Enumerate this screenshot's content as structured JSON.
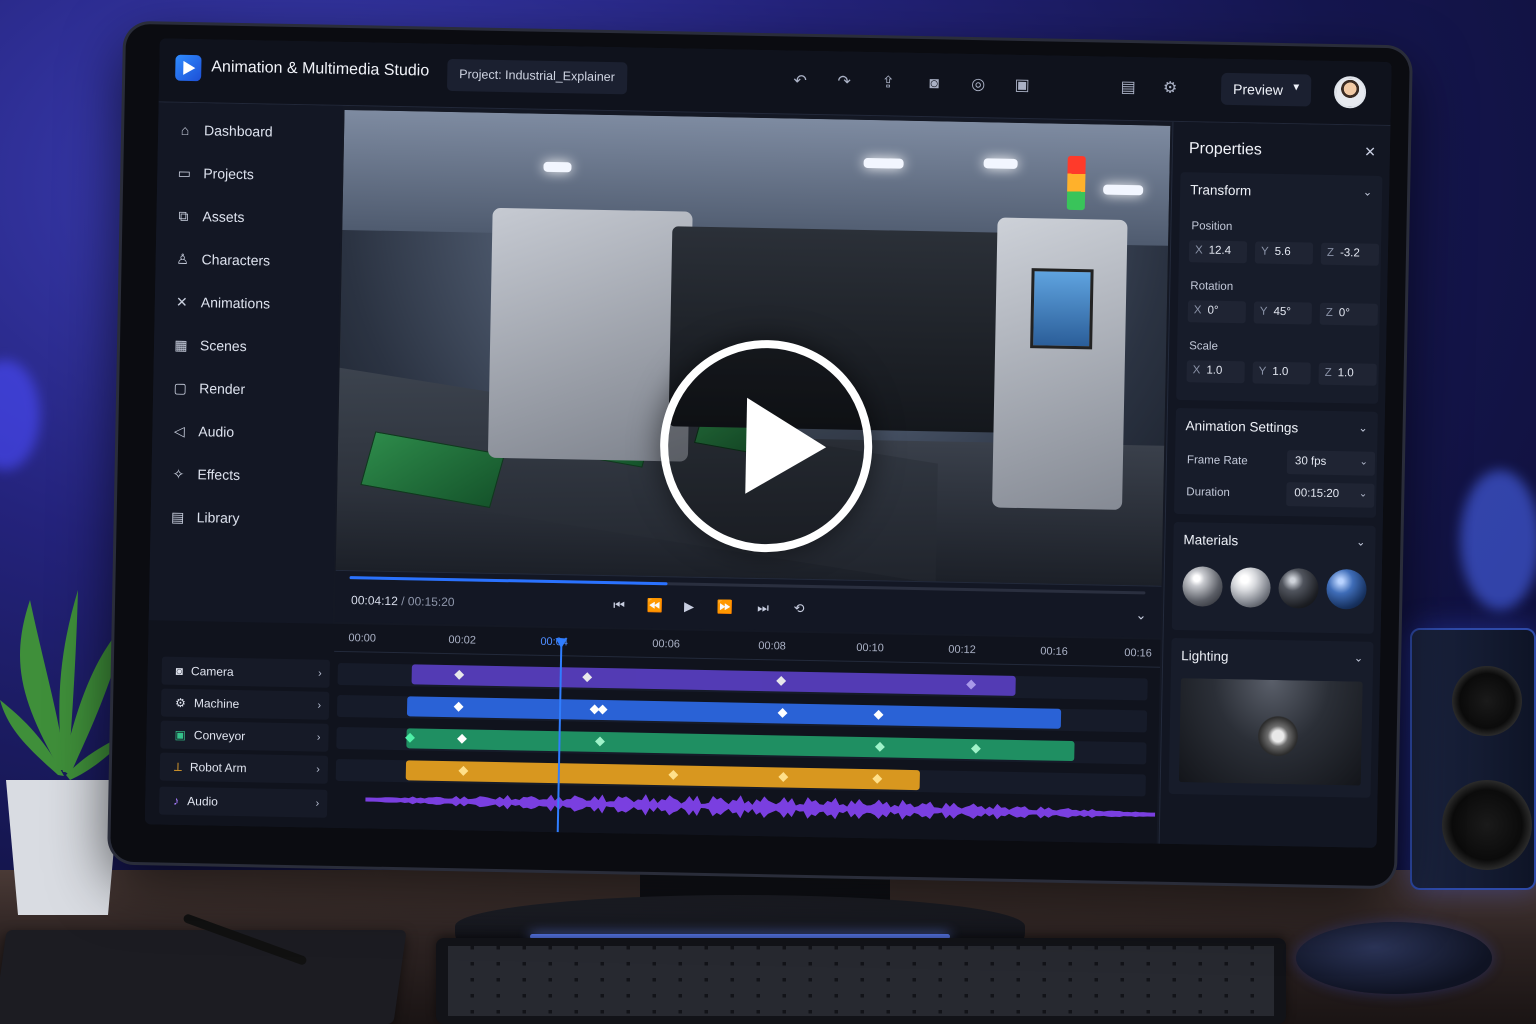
{
  "app": {
    "title": "Animation & Multimedia Studio",
    "project": "Project: Industrial_Explainer"
  },
  "toolbar": {
    "preview_label": "Preview",
    "icons": [
      "undo-icon",
      "redo-icon",
      "share-icon",
      "camera-tool-icon",
      "gizmo-icon",
      "export-icon",
      "layout-icon",
      "settings-icon"
    ]
  },
  "sidebar": {
    "items": [
      {
        "label": "Dashboard",
        "icon": "home-icon"
      },
      {
        "label": "Projects",
        "icon": "folder-icon"
      },
      {
        "label": "Assets",
        "icon": "assets-icon"
      },
      {
        "label": "Characters",
        "icon": "character-icon"
      },
      {
        "label": "Animations",
        "icon": "animation-icon"
      },
      {
        "label": "Scenes",
        "icon": "scenes-icon"
      },
      {
        "label": "Render",
        "icon": "render-icon"
      },
      {
        "label": "Audio",
        "icon": "speaker-icon"
      },
      {
        "label": "Effects",
        "icon": "effects-icon"
      },
      {
        "label": "Library",
        "icon": "library-icon"
      }
    ]
  },
  "player": {
    "current": "00:04:12",
    "total": "/ 00:15:20",
    "progress": 0.4
  },
  "timeline": {
    "ticks": [
      "00:00",
      "00:02",
      "00:04",
      "00:06",
      "00:08",
      "00:10",
      "00:12",
      "00:16",
      "00:16"
    ],
    "tracks": [
      {
        "label": "Camera",
        "color": "#6d4bd6"
      },
      {
        "label": "Machine",
        "color": "#2f6fe0"
      },
      {
        "label": "Conveyor",
        "color": "#27a072"
      },
      {
        "label": "Robot Arm",
        "color": "#e0a22a"
      },
      {
        "label": "Audio",
        "color": "#7a3fe0"
      }
    ]
  },
  "properties": {
    "title": "Properties",
    "transform": {
      "header": "Transform",
      "position_label": "Position",
      "position": {
        "x": "12.4",
        "y": "5.6",
        "z": "-3.2"
      },
      "rotation_label": "Rotation",
      "rotation": {
        "x": "0°",
        "y": "45°",
        "z": "0°"
      },
      "scale_label": "Scale",
      "scale": {
        "x": "1.0",
        "y": "1.0",
        "z": "1.0"
      }
    },
    "animation": {
      "header": "Animation Settings",
      "frame_rate_label": "Frame Rate",
      "frame_rate": "30 fps",
      "duration_label": "Duration",
      "duration": "00:15:20"
    },
    "materials": {
      "header": "Materials"
    },
    "lighting": {
      "header": "Lighting"
    }
  }
}
